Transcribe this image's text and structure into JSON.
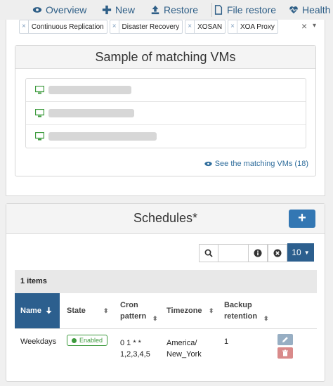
{
  "nav": {
    "overview": "Overview",
    "new": "New",
    "restore": "Restore",
    "file_restore": "File restore",
    "health": "Health"
  },
  "tags": [
    "Continuous Replication",
    "Disaster Recovery",
    "XOSAN",
    "XOA Proxy"
  ],
  "tag_remove_symbol": "×",
  "tag_clear_symbol": "×",
  "tag_caret": "▾",
  "vm_sample": {
    "title": "Sample of matching VMs",
    "see_link": "See the matching VMs (18)"
  },
  "schedules": {
    "title": "Schedules*",
    "add_label": "+",
    "page_size": "10",
    "items_count": "1 items",
    "columns": {
      "name": "Name",
      "state": "State",
      "cron": "Cron pattern",
      "timezone": "Timezone",
      "retention": "Backup retention"
    },
    "rows": [
      {
        "name": "Weekdays",
        "state": "Enabled",
        "cron": "0 1 * * 1,2,3,4,5",
        "timezone": "America/ New_York",
        "retention": "1"
      }
    ]
  },
  "colors": {
    "accent": "#2c5f8e",
    "primary_button": "#3377b3",
    "success": "#3c9a3c",
    "danger": "#d98a8a"
  }
}
